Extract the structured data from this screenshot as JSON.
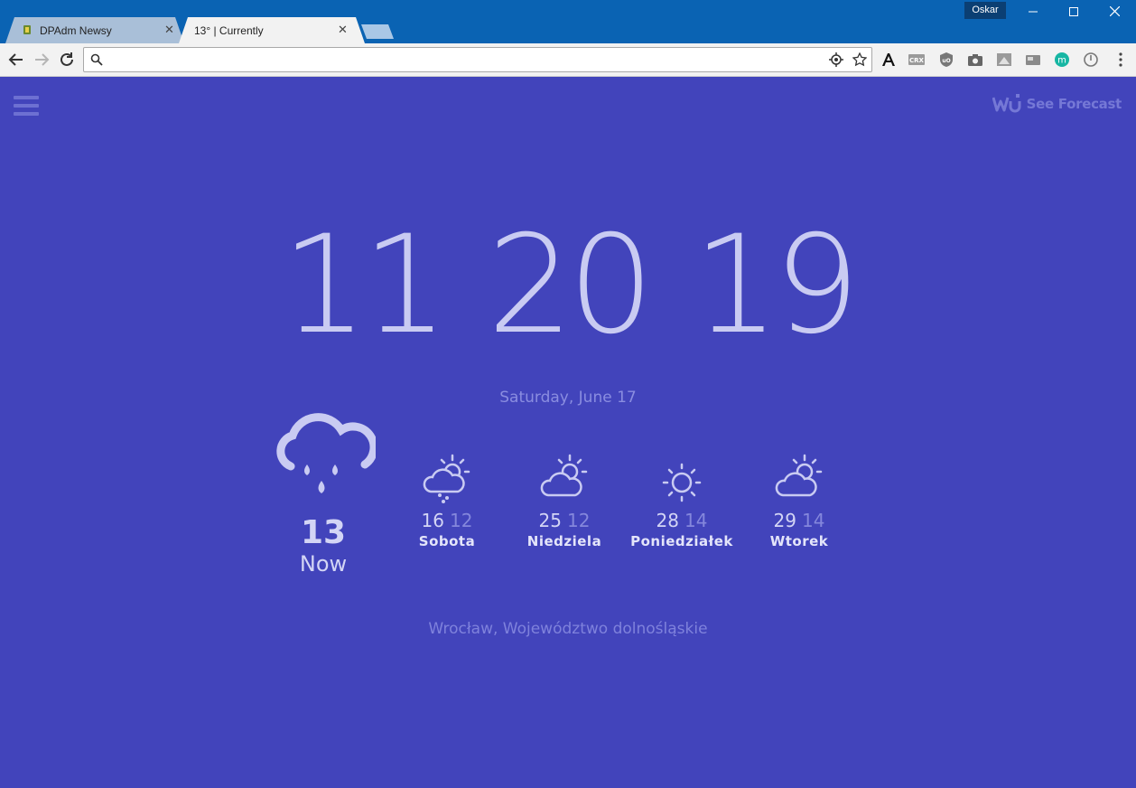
{
  "browser": {
    "tabs": [
      {
        "title": "DPAdm Newsy",
        "active": false
      },
      {
        "title": "13° | Currently",
        "active": true
      }
    ],
    "profile_name": "Oskar",
    "address_value": "",
    "window_controls": [
      "minimize",
      "maximize",
      "close"
    ],
    "extensions": [
      "font-a-icon",
      "crx-icon",
      "ublock-icon",
      "camera-icon",
      "screenshot-icon",
      "card-icon",
      "m-icon",
      "power-icon"
    ]
  },
  "header": {
    "menu_icon": "hamburger-icon",
    "forecast_link": "See Forecast",
    "brand": "WU"
  },
  "clock": {
    "hours": "11",
    "minutes": "20",
    "seconds": "19"
  },
  "date": "Saturday, June 17",
  "current": {
    "icon": "rain-cloud-icon",
    "temp": "13",
    "label": "Now"
  },
  "forecast": [
    {
      "day": "Sobota",
      "high": "16",
      "low": "12",
      "icon": "partly-cloudy-rain-icon"
    },
    {
      "day": "Niedziela",
      "high": "25",
      "low": "12",
      "icon": "partly-cloudy-icon"
    },
    {
      "day": "Poniedziałek",
      "high": "28",
      "low": "14",
      "icon": "sun-icon"
    },
    {
      "day": "Wtorek",
      "high": "29",
      "low": "14",
      "icon": "partly-cloudy-icon"
    }
  ],
  "location": "Wrocław, Województwo dolnośląskie",
  "colors": {
    "background": "#4244bb",
    "titlebar": "#0a63b3",
    "text_light": "#c9cbf2",
    "text_muted": "#8487dc"
  }
}
